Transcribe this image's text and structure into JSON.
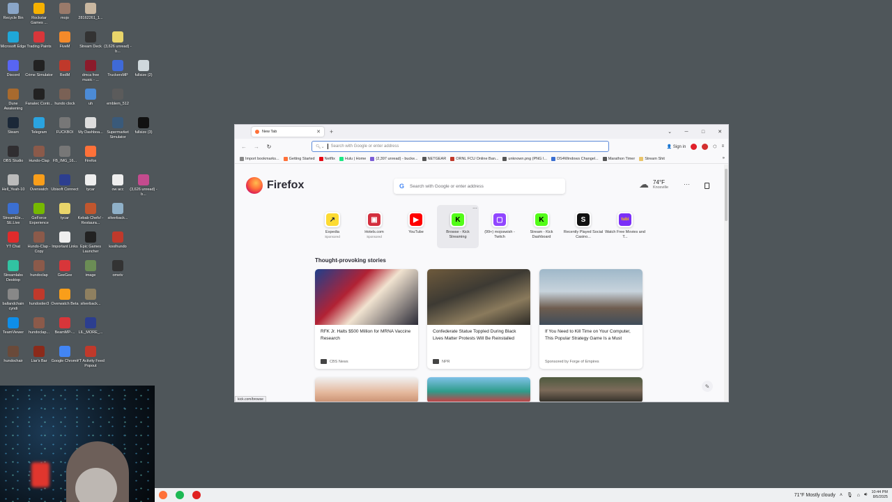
{
  "desktop": {
    "icons": [
      {
        "label": "Recycle Bin",
        "color": "#8aa6c8"
      },
      {
        "label": "Rockstar Games ...",
        "color": "#f6b100"
      },
      {
        "label": "mojo",
        "color": "#9a7a6a"
      },
      {
        "label": "28162261_1...",
        "color": "#c9b7a0"
      },
      {
        "label": "Microsoft Edge",
        "color": "#1fa7d8"
      },
      {
        "label": "Trading Paints",
        "color": "#d8363a"
      },
      {
        "label": "FiveM",
        "color": "#f58a2a"
      },
      {
        "label": "Stream Deck",
        "color": "#333"
      },
      {
        "label": "(3,626 unread) - b...",
        "color": "#e9d56a"
      },
      {
        "label": "Discord",
        "color": "#5865f2"
      },
      {
        "label": "Crime Simulator",
        "color": "#222"
      },
      {
        "label": "RedM",
        "color": "#c0392b"
      },
      {
        "label": "dmca free music - ...",
        "color": "#8c1b2b"
      },
      {
        "label": "TruckersMP",
        "color": "#3f6ad8"
      },
      {
        "label": "fullsize (2)",
        "color": "#cfd8dc"
      },
      {
        "label": "Dune Awakening",
        "color": "#a86a2e"
      },
      {
        "label": "Fanatec Contr...",
        "color": "#222"
      },
      {
        "label": "hundo clock",
        "color": "#7a6155"
      },
      {
        "label": "uh",
        "color": "#4c8bd6"
      },
      {
        "label": "emblem_512",
        "color": "#5b5b5b"
      },
      {
        "label": "Steam",
        "color": "#1b2838"
      },
      {
        "label": "Telegram",
        "color": "#2aa3df"
      },
      {
        "label": "FUCKBOI",
        "color": "#777"
      },
      {
        "label": "My Dashboa...",
        "color": "#ddd"
      },
      {
        "label": "Supermarket Simulator",
        "color": "#3a5a7a"
      },
      {
        "label": "fullsize (3)",
        "color": "#111"
      },
      {
        "label": "OBS Studio",
        "color": "#302e31"
      },
      {
        "label": "Hundo-Clap",
        "color": "#8b5a4a"
      },
      {
        "label": "FB_IMG_16...",
        "color": "#777"
      },
      {
        "label": "Firefox",
        "color": "#ff7139"
      },
      {
        "label": "Hell_Yeah-10",
        "color": "#bbb"
      },
      {
        "label": "Overwatch",
        "color": "#f99e1a"
      },
      {
        "label": "Ubisoft Connect",
        "color": "#2c3e8f"
      },
      {
        "label": "tycar",
        "color": "#eee"
      },
      {
        "label": "ow acc",
        "color": "#eee"
      },
      {
        "label": "(3,626 unread) - b...",
        "color": "#c44b8e"
      },
      {
        "label": "StreamEle... SE.Live",
        "color": "#3b6fd1"
      },
      {
        "label": "GeForce Experience",
        "color": "#76b900"
      },
      {
        "label": "tycar",
        "color": "#e9d56a"
      },
      {
        "label": "Kebab Chefs! - Restaura...",
        "color": "#c0562e"
      },
      {
        "label": "silverback...",
        "color": "#8fb0c8"
      },
      {
        "label": "YT Chat",
        "color": "#e02b2b"
      },
      {
        "label": "Hundo-Clap - Copy",
        "color": "#8b5a4a"
      },
      {
        "label": "Important Links",
        "color": "#eee"
      },
      {
        "label": "Epic Games Launcher",
        "color": "#222"
      },
      {
        "label": "koolhundo",
        "color": "#c0392b"
      },
      {
        "label": "Streamlabs Desktop",
        "color": "#31c3a2"
      },
      {
        "label": "hundoclap",
        "color": "#8b5a4a"
      },
      {
        "label": "GeeGee",
        "color": "#d8363a"
      },
      {
        "label": "image",
        "color": "#6b8d55"
      },
      {
        "label": "ometv",
        "color": "#333"
      },
      {
        "label": "ballandchain cyndi",
        "color": "#888"
      },
      {
        "label": "hundostier3",
        "color": "#c0392b"
      },
      {
        "label": "Overwatch Beta",
        "color": "#f99e1a"
      },
      {
        "label": "silverback...",
        "color": "#8f8060"
      },
      {
        "label": "TeamViewer",
        "color": "#0e8ee9"
      },
      {
        "label": "hundoclap...",
        "color": "#8b5a4a"
      },
      {
        "label": "BeamMP-...",
        "color": "#d8363a"
      },
      {
        "label": "LIL_MORE_...",
        "color": "#2c3e8f"
      },
      {
        "label": "hundochair",
        "color": "#6a4a3a"
      },
      {
        "label": "Liar's Bar",
        "color": "#8b2a1a"
      },
      {
        "label": "Google Chrome",
        "color": "#4285f4"
      },
      {
        "label": "YT Activity Feed Popout",
        "color": "#c0392b"
      }
    ]
  },
  "taskbar": {
    "apps": [
      {
        "name": "firefox",
        "color": "#ff7139"
      },
      {
        "name": "spotify",
        "color": "#1db954"
      },
      {
        "name": "app",
        "color": "#e02020"
      }
    ],
    "weather": "71°F  Mostly cloudy",
    "time": "10:44 PM",
    "date": "8/5/2025"
  },
  "browser": {
    "tab_title": "New Tab",
    "url_placeholder": "Search with Google or enter address",
    "sign_in": "Sign in",
    "bookmarks": [
      {
        "label": "Import bookmarks...",
        "color": "#888"
      },
      {
        "label": "Getting Started",
        "color": "#ff7139"
      },
      {
        "label": "Netflix",
        "color": "#e50914"
      },
      {
        "label": "Hulu | Home",
        "color": "#1ce783"
      },
      {
        "label": "(2,397 unread) - bucke...",
        "color": "#7b5cd6"
      },
      {
        "label": "NETGEAR",
        "color": "#555"
      },
      {
        "label": "ORNL FCU Online Ban...",
        "color": "#c0392b"
      },
      {
        "label": "unknown.png (PNG I...",
        "color": "#555"
      },
      {
        "label": "DS4Windows Changel...",
        "color": "#3b6fd1"
      },
      {
        "label": "Marathon Timer",
        "color": "#555"
      },
      {
        "label": "Stream Shit",
        "color": "#e9c46a"
      }
    ],
    "status_url": "kick.com/browse"
  },
  "newtab": {
    "brand": "Firefox",
    "search_placeholder": "Search with Google or enter address",
    "weather": {
      "temp": "74°F",
      "city": "Knoxville"
    },
    "top_sites": [
      {
        "name": "Expedia",
        "sponsored": "Sponsored",
        "glyph": "↗",
        "bg": "#fddb32",
        "fg": "#1e243a"
      },
      {
        "name": "Hotels.com",
        "sponsored": "Sponsored",
        "glyph": "▣",
        "bg": "#d32f3e",
        "fg": "#ffffff"
      },
      {
        "name": "YouTube",
        "sponsored": "",
        "glyph": "▶",
        "bg": "#ff0000",
        "fg": "#ffffff"
      },
      {
        "name": "Browse - Kick Streaming",
        "sponsored": "",
        "glyph": "K",
        "bg": "#53fc18",
        "fg": "#000000"
      },
      {
        "name": "(99+) mojoswish - Twitch",
        "sponsored": "",
        "glyph": "▢",
        "bg": "#9146ff",
        "fg": "#ffffff"
      },
      {
        "name": "Stream - Kick Dashboard",
        "sponsored": "",
        "glyph": "K",
        "bg": "#53fc18",
        "fg": "#000000"
      },
      {
        "name": "Recently Played Social Casino...",
        "sponsored": "",
        "glyph": "S",
        "bg": "#111111",
        "fg": "#ffffff"
      },
      {
        "name": "Watch Free Movies and T...",
        "sponsored": "",
        "glyph": "tubi",
        "bg": "#7b2ff7",
        "fg": "#ffcc00"
      }
    ],
    "stories_title": "Thought-provoking stories",
    "stories": [
      {
        "headline": "RFK Jr. Halts $500 Million for MRNA Vaccine Research",
        "source": "CBS News",
        "img": "linear-gradient(135deg,#1f3f8c 0%,#b22234 35%,#f1e3d0 55%,#2a2a36 100%)"
      },
      {
        "headline": "Confederate Statue Toppled During Black Lives Matter Protests Will Be Reinstalled",
        "source": "NPR",
        "img": "linear-gradient(160deg,#6e5a3c 0%,#3d3a33 40%,#8a7a5c 70%,#2c2a26 100%)"
      },
      {
        "headline": "If You Need to Kill Time on Your Computer, This Popular Strategy Game Is a Must",
        "source": "Sponsored by Forge of Empires",
        "img": "linear-gradient(180deg,#9fb8c9 0%,#c7d3dc 40%,#6e5d4f 70%,#3f4d5a 100%)"
      }
    ],
    "stories_row2": [
      {
        "img": "linear-gradient(180deg,#f0f0f0 0%,#e4b79c 60%,#c98f70 100%)"
      },
      {
        "img": "linear-gradient(180deg,#7fc1e8 0%,#2f9c8b 55%,#d4363c 100%)"
      },
      {
        "img": "linear-gradient(180deg,#4e5a3f 0%,#7c6b5a 50%,#2d2b25 100%)"
      }
    ]
  }
}
